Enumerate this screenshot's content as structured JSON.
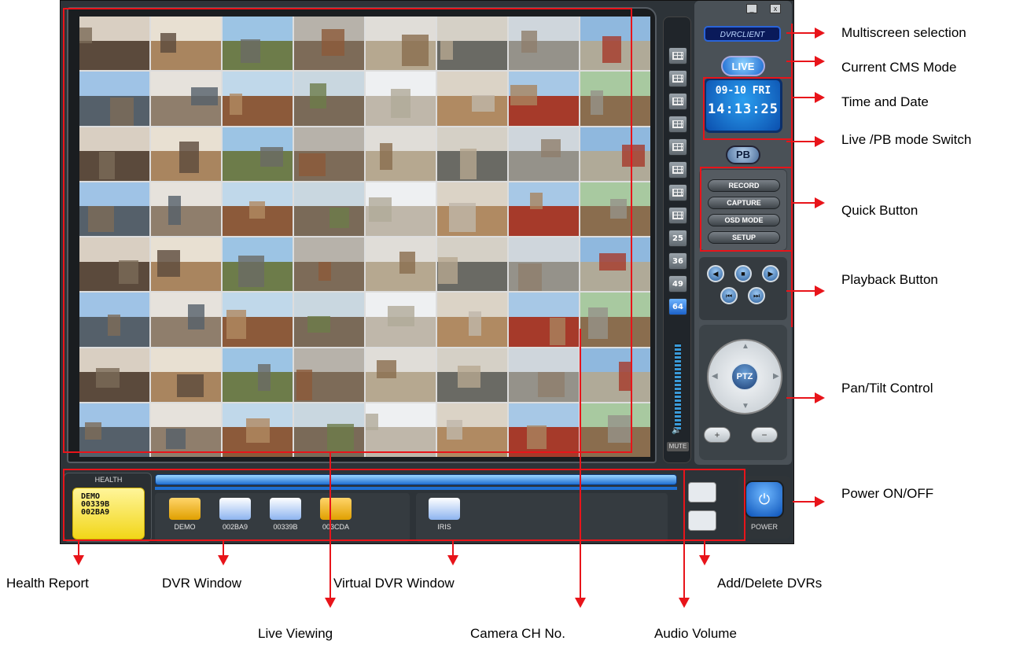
{
  "app": {
    "brand": "DVRCLIENT",
    "mode": "LIVE",
    "date": "09-10  FRI",
    "time": "14:13:25",
    "pb_label": "PB",
    "window_controls": [
      "_",
      "x"
    ]
  },
  "screen_selector": {
    "buttons": [
      "1x1",
      "2x2",
      "3x3",
      "4x4",
      "5x5",
      "6x6",
      "7x7",
      "8x8",
      "25",
      "36",
      "49",
      "64"
    ],
    "active": "64",
    "mute_label": "MUTE",
    "volume_level": 0.85
  },
  "quick_buttons": [
    "RECORD",
    "CAPTURE",
    "OSD MODE",
    "SETUP"
  ],
  "playback_buttons": [
    "rewind",
    "stop",
    "play",
    "prev",
    "next"
  ],
  "ptz": {
    "label": "PTZ",
    "zoom_in": "+",
    "zoom_out": "−"
  },
  "health": {
    "title": "HEALTH",
    "lines": [
      "DEMO",
      "00339B",
      "002BA9"
    ]
  },
  "dvr_window": {
    "items": [
      {
        "label": "DEMO",
        "status": "warning"
      },
      {
        "label": "002BA9",
        "status": "ok"
      },
      {
        "label": "00339B",
        "status": "ok"
      },
      {
        "label": "003CDA",
        "status": "alert"
      }
    ]
  },
  "virtual_dvr_window": {
    "items": [
      {
        "label": "IRIS"
      }
    ]
  },
  "power": {
    "label": "POWER"
  },
  "callouts": {
    "multiscreen": "Multiscreen selection",
    "cms_mode": "Current CMS Mode",
    "time_date": "Time and Date",
    "live_pb": "Live /PB mode Switch",
    "quick": "Quick Button",
    "playback": "Playback Button",
    "pan_tilt": "Pan/Tilt Control",
    "power": "Power ON/OFF",
    "health": "Health Report",
    "dvr_window": "DVR Window",
    "virtual_dvr": "Virtual DVR Window",
    "add_delete": "Add/Delete DVRs",
    "live_viewing": "Live Viewing",
    "camera_ch": "Camera CH No.",
    "audio_volume": "Audio Volume"
  },
  "colors": {
    "annotation": "#e8141a",
    "frame": "#2d3338",
    "accent_blue": "#1f6bd1",
    "health_yellow": "#f2d618"
  }
}
